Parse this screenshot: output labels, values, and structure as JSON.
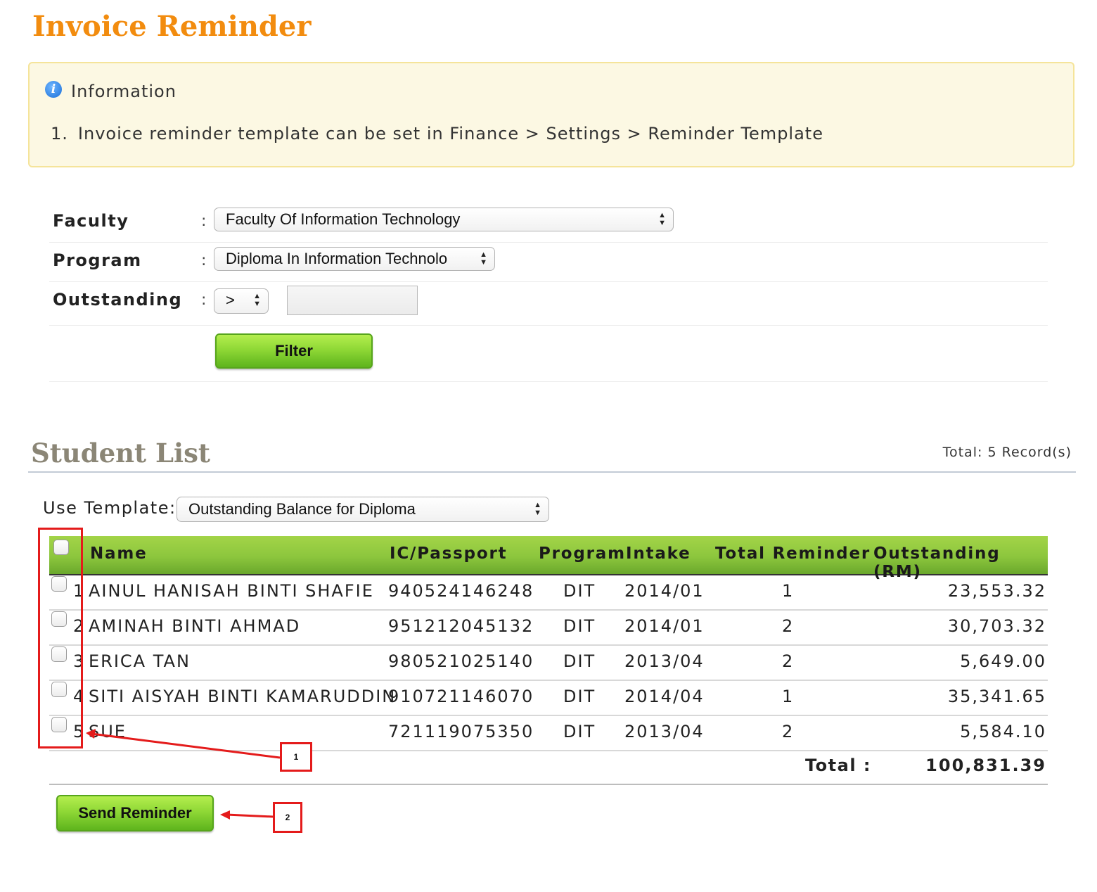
{
  "page": {
    "title": "Invoice Reminder"
  },
  "info": {
    "heading": "Information",
    "items": [
      {
        "num": "1.",
        "text": "Invoice reminder template can be set in Finance > Settings > Reminder Template"
      }
    ]
  },
  "filter": {
    "faculty": {
      "label": "Faculty",
      "colon": ":",
      "value": "Faculty Of Information Technology"
    },
    "program": {
      "label": "Program",
      "colon": ":",
      "value": "Diploma In Information Technolo"
    },
    "outstanding": {
      "label": "Outstanding",
      "colon": ":",
      "operator": ">",
      "amount": ""
    },
    "button_label": "Filter"
  },
  "student_list": {
    "title": "Student List",
    "record_count": "Total: 5 Record(s)",
    "template_label": "Use Template:",
    "template_value": "Outstanding Balance for Diploma",
    "columns": [
      "Name",
      "IC/Passport",
      "Program",
      "Intake",
      "Total Reminder",
      "Outstanding (RM)"
    ],
    "rows": [
      {
        "no": "1",
        "name": "AINUL HANISAH BINTI SHAFIE",
        "ic": "940524146248",
        "program": "DIT",
        "intake": "2014/01",
        "reminders": "1",
        "outstanding": "23,553.32"
      },
      {
        "no": "2",
        "name": "AMINAH BINTI AHMAD",
        "ic": "951212045132",
        "program": "DIT",
        "intake": "2014/01",
        "reminders": "2",
        "outstanding": "30,703.32"
      },
      {
        "no": "3",
        "name": "ERICA TAN",
        "ic": "980521025140",
        "program": "DIT",
        "intake": "2013/04",
        "reminders": "2",
        "outstanding": "5,649.00"
      },
      {
        "no": "4",
        "name": "SITI AISYAH BINTI KAMARUDDIN",
        "ic": "910721146070",
        "program": "DIT",
        "intake": "2014/04",
        "reminders": "1",
        "outstanding": "35,341.65"
      },
      {
        "no": "5",
        "name": "SUE",
        "ic": "721119075350",
        "program": "DIT",
        "intake": "2013/04",
        "reminders": "2",
        "outstanding": "5,584.10"
      }
    ],
    "total_label": "Total :",
    "total_value": "100,831.39",
    "send_button_label": "Send Reminder"
  },
  "annotations": {
    "callout_1": "1",
    "callout_2": "2"
  },
  "colors": {
    "title_orange": "#f28c0f",
    "header_green": "#8cc63d",
    "button_green": "#8fd836",
    "annotation_red": "#e41b1b",
    "info_bg": "#fcf8e3"
  }
}
